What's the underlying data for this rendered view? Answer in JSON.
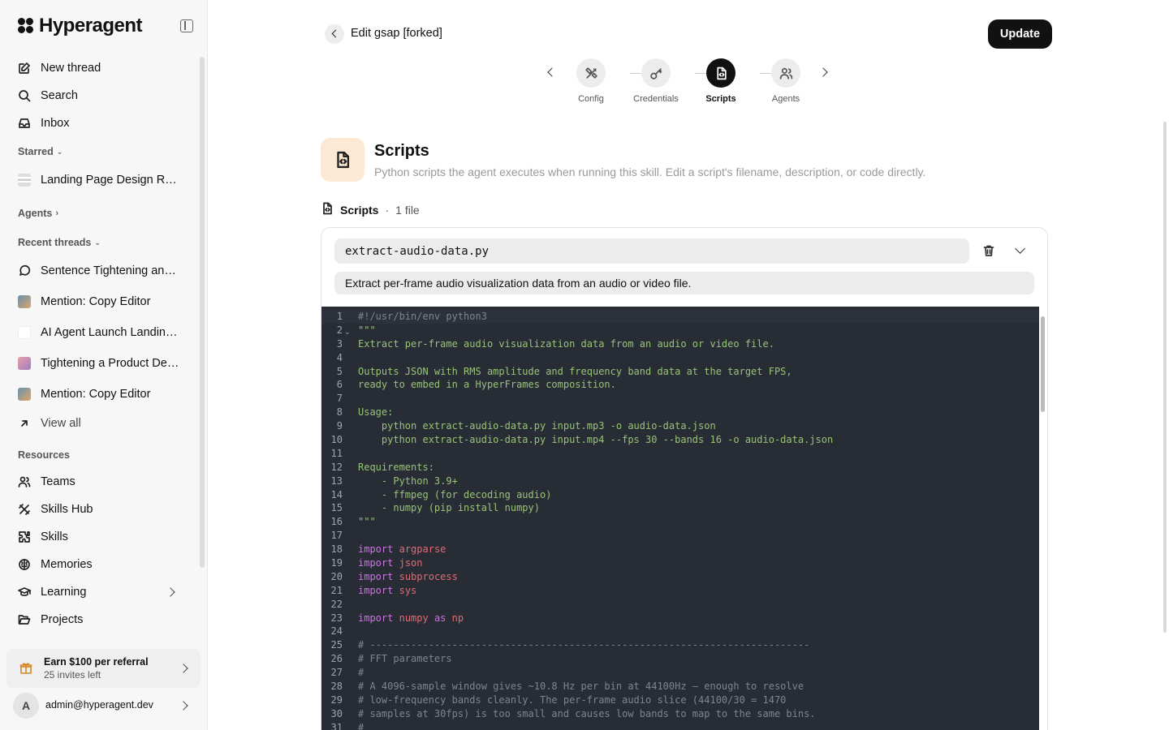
{
  "app": {
    "brand": "Hyperagent"
  },
  "sidebar": {
    "nav": [
      {
        "label": "New thread",
        "icon": "edit-icon"
      },
      {
        "label": "Search",
        "icon": "search-icon"
      },
      {
        "label": "Inbox",
        "icon": "inbox-icon"
      }
    ],
    "starred_label": "Starred",
    "starred": [
      {
        "label": "Landing Page Design Rev..."
      }
    ],
    "agents_label": "Agents",
    "recent_label": "Recent threads",
    "recent": [
      {
        "label": "Sentence Tightening and ...",
        "icon": "chat-icon"
      },
      {
        "label": "Mention: Copy Editor",
        "icon": "thumbnail"
      },
      {
        "label": "AI Agent Launch Landing ...",
        "icon": "thumbnail"
      },
      {
        "label": "Tightening a Product Des...",
        "icon": "thumbnail"
      },
      {
        "label": "Mention: Copy Editor",
        "icon": "thumbnail"
      }
    ],
    "view_all": "View all",
    "resources_label": "Resources",
    "resources": [
      {
        "label": "Teams",
        "icon": "users-icon"
      },
      {
        "label": "Skills Hub",
        "icon": "skills-hub-icon"
      },
      {
        "label": "Skills",
        "icon": "puzzle-icon"
      },
      {
        "label": "Memories",
        "icon": "brain-icon"
      },
      {
        "label": "Learning",
        "icon": "graduation-cap-icon"
      },
      {
        "label": "Projects",
        "icon": "folder-icon"
      }
    ],
    "referral": {
      "title": "Earn $100 per referral",
      "subtitle": "25 invites left"
    },
    "account": {
      "initial": "A",
      "email": "admin@hyperagent.dev"
    }
  },
  "header": {
    "title": "Edit gsap [forked]",
    "update_label": "Update"
  },
  "stepper": {
    "steps": [
      {
        "label": "Config",
        "icon": "tools-icon"
      },
      {
        "label": "Credentials",
        "icon": "key-icon"
      },
      {
        "label": "Scripts",
        "icon": "file-code-icon",
        "active": true
      },
      {
        "label": "Agents",
        "icon": "users-icon"
      }
    ]
  },
  "section": {
    "title": "Scripts",
    "description": "Python scripts the agent executes when running this skill. Edit a script's filename, description, or code directly.",
    "files_label": "Scripts",
    "separator": "·",
    "files_count": "1 file"
  },
  "script": {
    "filename": "extract-audio-data.py",
    "description": "Extract per-frame audio visualization data from an audio or video file."
  },
  "code_lines": [
    {
      "n": "1",
      "text": "#!/usr/bin/env python3",
      "cls": "c-comment"
    },
    {
      "n": "2",
      "text": "\"\"\"",
      "cls": "c-doc"
    },
    {
      "n": "3",
      "text": "Extract per-frame audio visualization data from an audio or video file.",
      "cls": "c-doc"
    },
    {
      "n": "4",
      "text": "",
      "cls": "c-doc"
    },
    {
      "n": "5",
      "text": "Outputs JSON with RMS amplitude and frequency band data at the target FPS,",
      "cls": "c-doc"
    },
    {
      "n": "6",
      "text": "ready to embed in a HyperFrames composition.",
      "cls": "c-doc"
    },
    {
      "n": "7",
      "text": "",
      "cls": "c-doc"
    },
    {
      "n": "8",
      "text": "Usage:",
      "cls": "c-doc"
    },
    {
      "n": "9",
      "text": "    python extract-audio-data.py input.mp3 -o audio-data.json",
      "cls": "c-doc"
    },
    {
      "n": "10",
      "text": "    python extract-audio-data.py input.mp4 --fps 30 --bands 16 -o audio-data.json",
      "cls": "c-doc"
    },
    {
      "n": "11",
      "text": "",
      "cls": "c-doc"
    },
    {
      "n": "12",
      "text": "Requirements:",
      "cls": "c-doc"
    },
    {
      "n": "13",
      "text": "    - Python 3.9+",
      "cls": "c-doc"
    },
    {
      "n": "14",
      "text": "    - ffmpeg (for decoding audio)",
      "cls": "c-doc"
    },
    {
      "n": "15",
      "text": "    - numpy (pip install numpy)",
      "cls": "c-doc"
    },
    {
      "n": "16",
      "text": "\"\"\"",
      "cls": "c-doc"
    },
    {
      "n": "17",
      "text": "",
      "cls": ""
    },
    {
      "n": "18",
      "kw": "import",
      "mod": "argparse"
    },
    {
      "n": "19",
      "kw": "import",
      "mod": "json"
    },
    {
      "n": "20",
      "kw": "import",
      "mod": "subprocess"
    },
    {
      "n": "21",
      "kw": "import",
      "mod": "sys"
    },
    {
      "n": "22",
      "text": "",
      "cls": ""
    },
    {
      "n": "23",
      "kw": "import",
      "mod": "numpy",
      "kw2": "as",
      "mod2": "np"
    },
    {
      "n": "24",
      "text": "",
      "cls": ""
    },
    {
      "n": "25",
      "text": "# ---------------------------------------------------------------------------",
      "cls": "c-comment"
    },
    {
      "n": "26",
      "text": "# FFT parameters",
      "cls": "c-comment"
    },
    {
      "n": "27",
      "text": "#",
      "cls": "c-comment"
    },
    {
      "n": "28",
      "text": "# A 4096-sample window gives ~10.8 Hz per bin at 44100Hz — enough to resolve",
      "cls": "c-comment"
    },
    {
      "n": "29",
      "text": "# low-frequency bands cleanly. The per-frame audio slice (44100/30 = 1470",
      "cls": "c-comment"
    },
    {
      "n": "30",
      "text": "# samples at 30fps) is too small and causes low bands to map to the same bins.",
      "cls": "c-comment"
    },
    {
      "n": "31",
      "text": "#",
      "cls": "c-comment"
    }
  ],
  "colors": {
    "editor_bg": "#282c34",
    "docstring": "#98c379",
    "comment": "#7f848e",
    "keyword": "#c678dd",
    "module": "#e06c75",
    "scripts_icon_bg": "#fde9d3"
  }
}
